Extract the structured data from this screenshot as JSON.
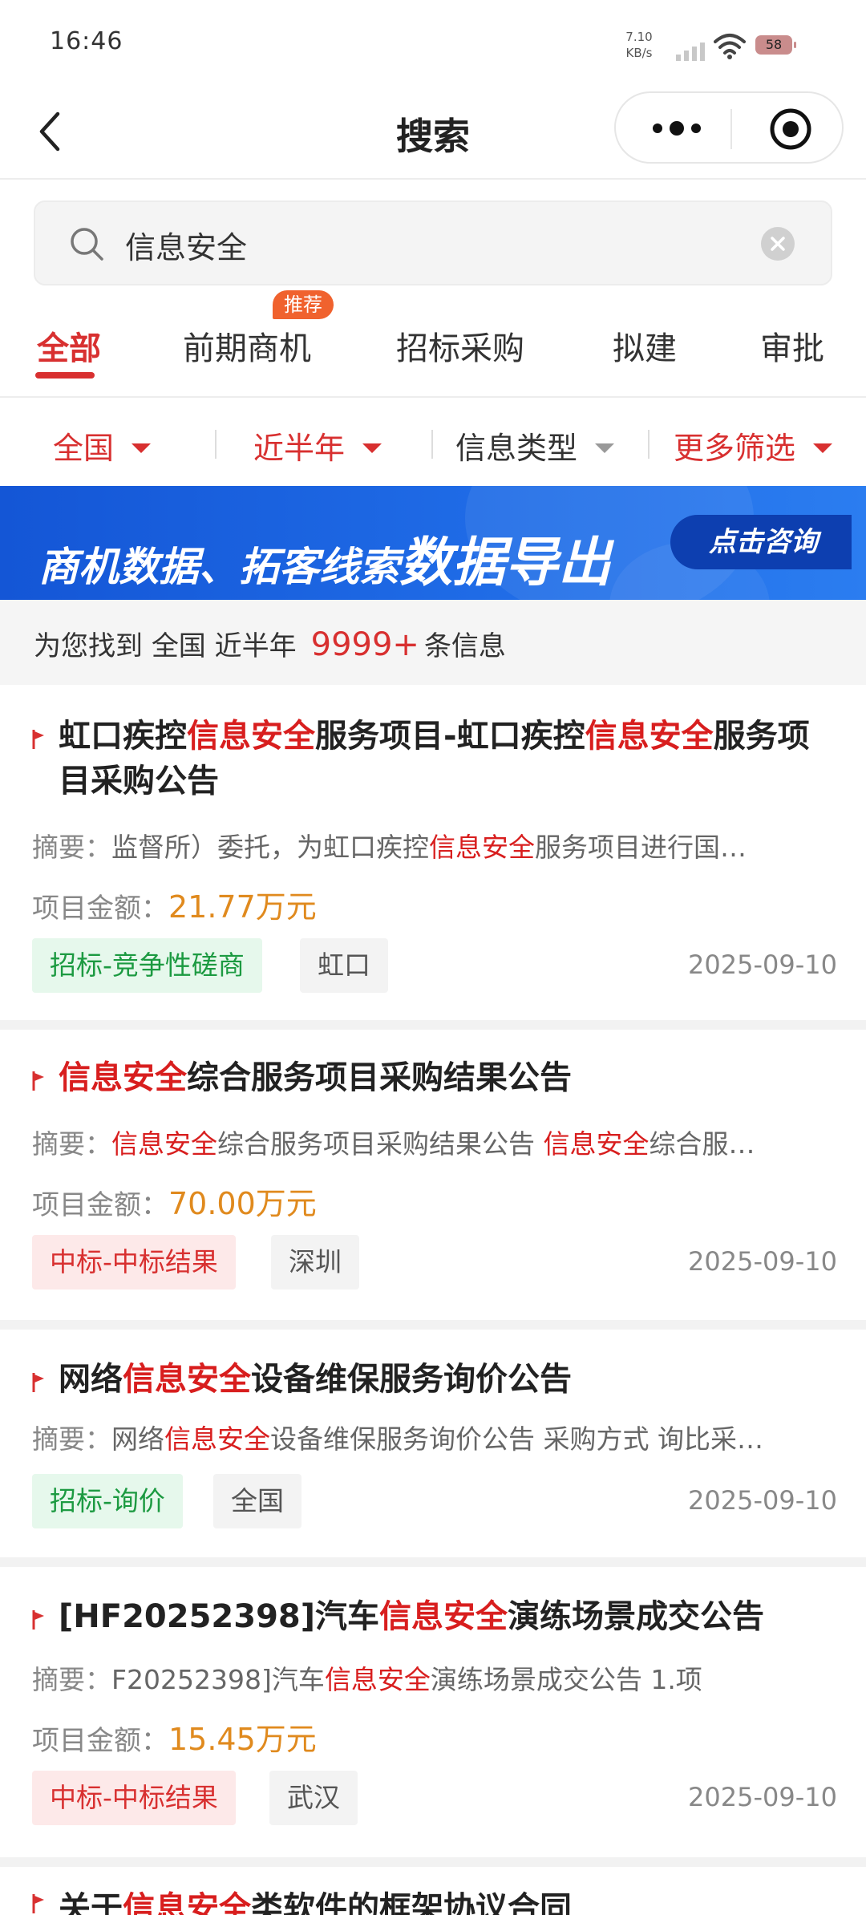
{
  "status_bar": {
    "time": "16:46",
    "net_speed_value": "7.10",
    "net_speed_unit": "KB/s",
    "battery": "58"
  },
  "nav": {
    "title": "搜索",
    "icons": [
      "back-icon",
      "more-icon",
      "close-miniprogram-icon"
    ]
  },
  "search": {
    "query": "信息安全",
    "icons": [
      "search-icon",
      "clear-icon"
    ]
  },
  "tabs": {
    "items": [
      "全部",
      "前期商机",
      "招标采购",
      "拟建",
      "审批"
    ],
    "active": "全部",
    "badge": "推荐"
  },
  "filters": {
    "region": "全国",
    "time": "近半年",
    "type": "信息类型",
    "more": "更多筛选"
  },
  "banner": {
    "text": "商机数据、拓客线索",
    "highlight": "数据导出",
    "button": "点击咨询"
  },
  "summary": {
    "prefix": "为您找到",
    "region": "全国",
    "period": "近半年",
    "count": "9999+",
    "suffix": "条信息"
  },
  "results": [
    {
      "title_parts": [
        "虹口疾控",
        "信息安全",
        "服务项目-虹口疾控",
        "信息安全",
        "服务项目采购公告"
      ],
      "abstract_label": "摘要：",
      "abstract_parts": [
        "监督所）委托，为虹口疾控",
        "信息安全",
        "服务项目进行国…"
      ],
      "amount_label": "项目金额：",
      "amount": "21.77万元",
      "tag": "招标-竞争性磋商",
      "location": "虹口",
      "date": "2025-09-10"
    },
    {
      "title_parts": [
        "",
        "信息安全",
        "综合服务项目采购结果公告"
      ],
      "abstract_label": "摘要：",
      "abstract_parts": [
        "",
        "信息安全",
        "综合服务项目采购结果公告 ",
        "信息安全",
        "综合服…"
      ],
      "amount_label": "项目金额：",
      "amount": "70.00万元",
      "tag": "中标-中标结果",
      "location": "深圳",
      "date": "2025-09-10"
    },
    {
      "title_parts": [
        "网络",
        "信息安全",
        "设备维保服务询价公告"
      ],
      "abstract_label": "摘要：",
      "abstract_parts": [
        "网络",
        "信息安全",
        "设备维保服务询价公告 采购方式 询比采…"
      ],
      "tag": "招标-询价",
      "location": "全国",
      "date": "2025-09-10"
    },
    {
      "title_parts": [
        "[HF20252398]汽车",
        "信息安全",
        "演练场景成交公告"
      ],
      "abstract_label": "摘要：",
      "abstract_parts": [
        "F20252398]汽车",
        "信息安全",
        "演练场景成交公告 1.项"
      ],
      "amount_label": "项目金额：",
      "amount": "15.45万元",
      "tag": "中标-中标结果",
      "location": "武汉",
      "date": "2025-09-10"
    },
    {
      "title_parts": [
        "关于",
        "信息安全",
        "类软件的框架协议合同"
      ]
    }
  ],
  "colors": {
    "accent": "#d83030",
    "highlight": "#d81e1e",
    "amount": "#e08a1e",
    "banner": "#1f6be6",
    "tag_green_bg": "#e6f8ec",
    "tag_red_bg": "#fde9e9"
  }
}
